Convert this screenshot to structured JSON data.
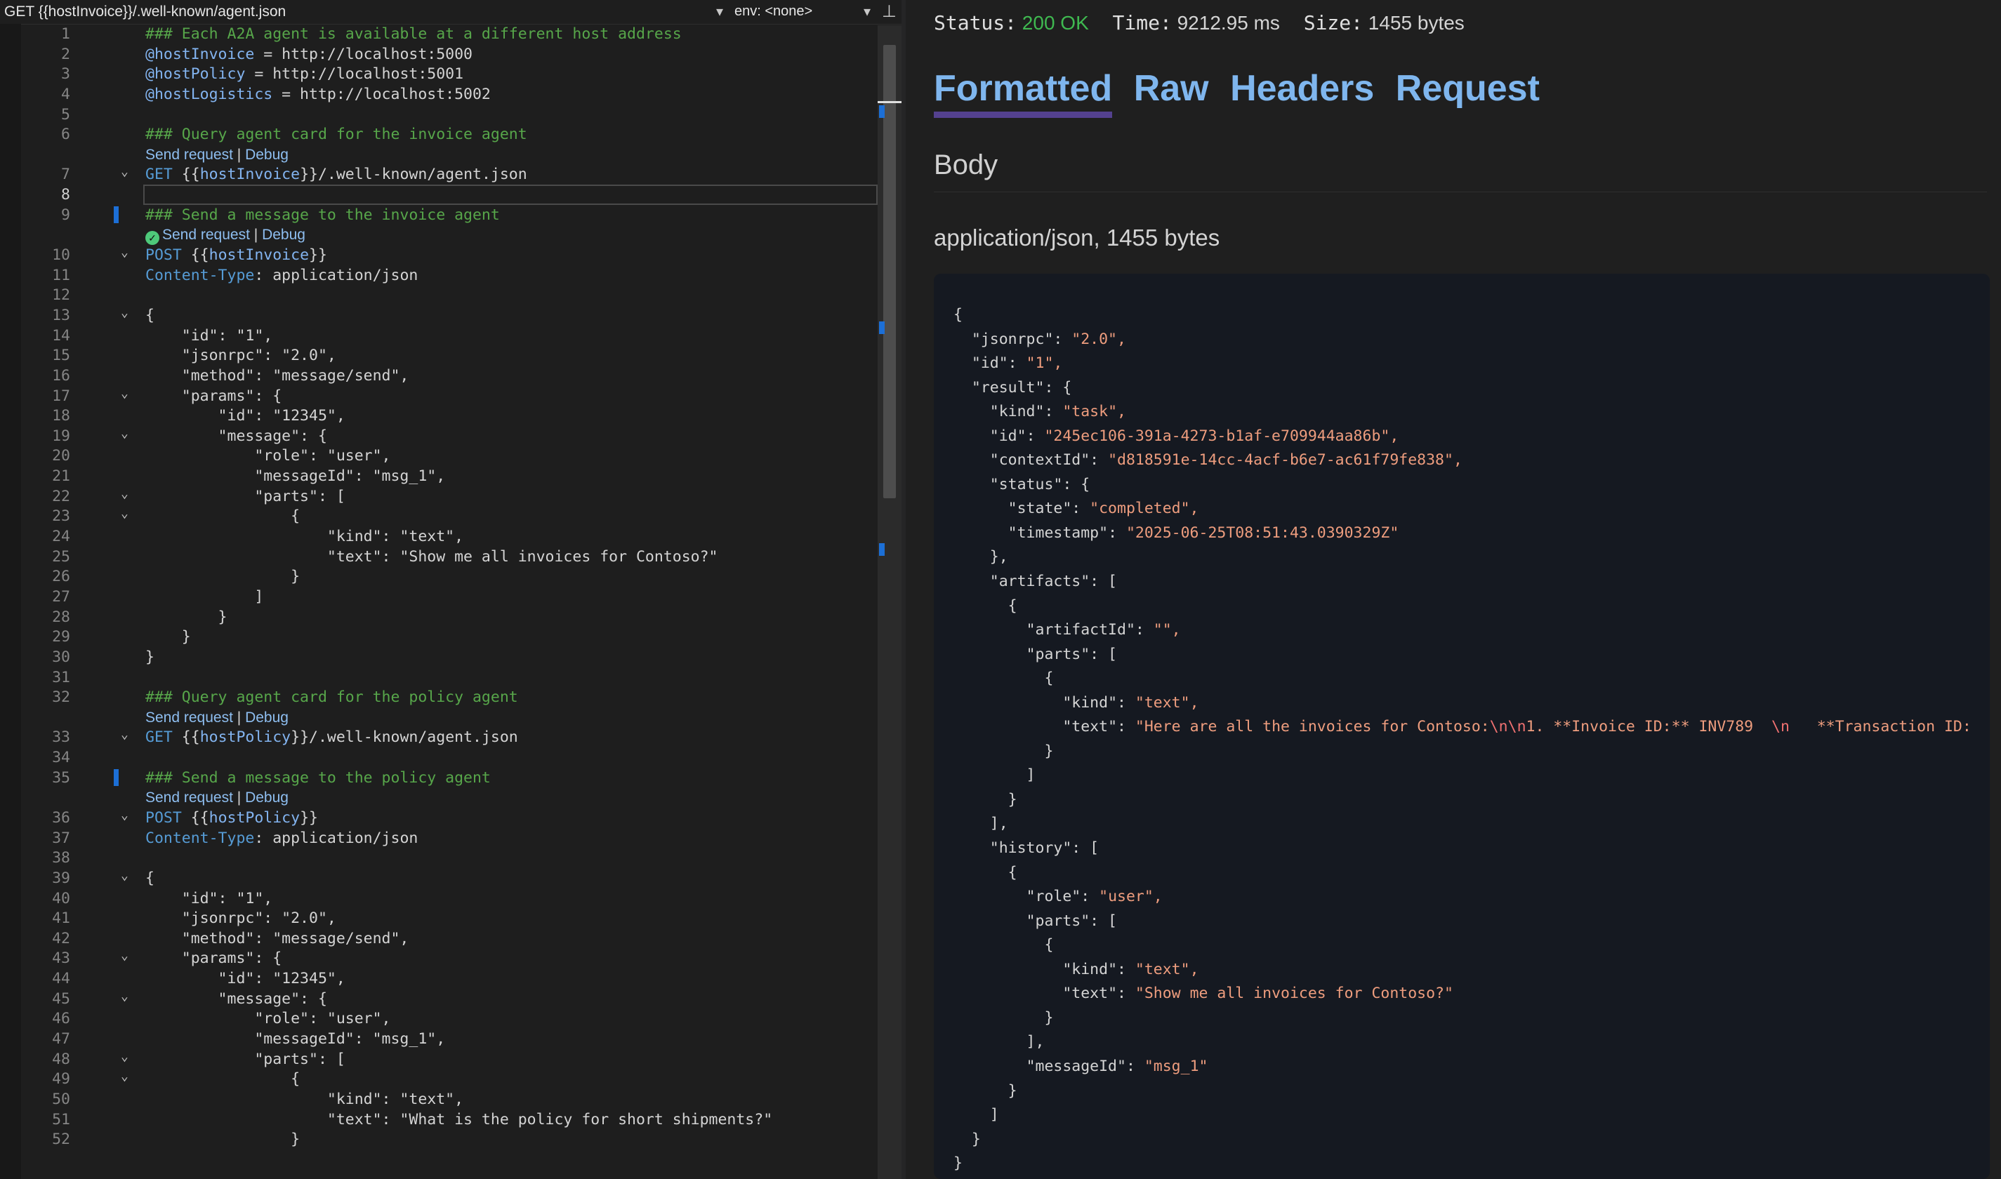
{
  "editor": {
    "nav_title": "GET {{hostInvoice}}/.well-known/agent.json",
    "env_select": "env: <none>",
    "code_lens": {
      "send": "Send request",
      "sep": "|",
      "debug": "Debug"
    },
    "lines": [
      {
        "n": "1",
        "t": "### Each A2A agent is available at a different host address"
      },
      {
        "n": "2",
        "t": "@hostInvoice = http://localhost:5000"
      },
      {
        "n": "3",
        "t": "@hostPolicy = http://localhost:5001"
      },
      {
        "n": "4",
        "t": "@hostLogistics = http://localhost:5002"
      },
      {
        "n": "5",
        "t": ""
      },
      {
        "n": "6",
        "t": "### Query agent card for the invoice agent"
      },
      {
        "n": "",
        "t": "LENS"
      },
      {
        "n": "7",
        "t": "GET {{hostInvoice}}/.well-known/agent.json"
      },
      {
        "n": "8",
        "t": ""
      },
      {
        "n": "9",
        "t": "### Send a message to the invoice agent"
      },
      {
        "n": "",
        "t": "LENS_OK"
      },
      {
        "n": "10",
        "t": "POST {{hostInvoice}}"
      },
      {
        "n": "11",
        "t": "Content-Type: application/json"
      },
      {
        "n": "12",
        "t": ""
      },
      {
        "n": "13",
        "t": "{"
      },
      {
        "n": "14",
        "t": "    \"id\": \"1\","
      },
      {
        "n": "15",
        "t": "    \"jsonrpc\": \"2.0\","
      },
      {
        "n": "16",
        "t": "    \"method\": \"message/send\","
      },
      {
        "n": "17",
        "t": "    \"params\": {"
      },
      {
        "n": "18",
        "t": "        \"id\": \"12345\","
      },
      {
        "n": "19",
        "t": "        \"message\": {"
      },
      {
        "n": "20",
        "t": "            \"role\": \"user\","
      },
      {
        "n": "21",
        "t": "            \"messageId\": \"msg_1\","
      },
      {
        "n": "22",
        "t": "            \"parts\": ["
      },
      {
        "n": "23",
        "t": "                {"
      },
      {
        "n": "24",
        "t": "                    \"kind\": \"text\","
      },
      {
        "n": "25",
        "t": "                    \"text\": \"Show me all invoices for Contoso?\""
      },
      {
        "n": "26",
        "t": "                }"
      },
      {
        "n": "27",
        "t": "            ]"
      },
      {
        "n": "28",
        "t": "        }"
      },
      {
        "n": "29",
        "t": "    }"
      },
      {
        "n": "30",
        "t": "}"
      },
      {
        "n": "31",
        "t": ""
      },
      {
        "n": "32",
        "t": "### Query agent card for the policy agent"
      },
      {
        "n": "",
        "t": "LENS"
      },
      {
        "n": "33",
        "t": "GET {{hostPolicy}}/.well-known/agent.json"
      },
      {
        "n": "34",
        "t": ""
      },
      {
        "n": "35",
        "t": "### Send a message to the policy agent"
      },
      {
        "n": "",
        "t": "LENS"
      },
      {
        "n": "36",
        "t": "POST {{hostPolicy}}"
      },
      {
        "n": "37",
        "t": "Content-Type: application/json"
      },
      {
        "n": "38",
        "t": ""
      },
      {
        "n": "39",
        "t": "{"
      },
      {
        "n": "40",
        "t": "    \"id\": \"1\","
      },
      {
        "n": "41",
        "t": "    \"jsonrpc\": \"2.0\","
      },
      {
        "n": "42",
        "t": "    \"method\": \"message/send\","
      },
      {
        "n": "43",
        "t": "    \"params\": {"
      },
      {
        "n": "44",
        "t": "        \"id\": \"12345\","
      },
      {
        "n": "45",
        "t": "        \"message\": {"
      },
      {
        "n": "46",
        "t": "            \"role\": \"user\","
      },
      {
        "n": "47",
        "t": "            \"messageId\": \"msg_1\","
      },
      {
        "n": "48",
        "t": "            \"parts\": ["
      },
      {
        "n": "49",
        "t": "                {"
      },
      {
        "n": "50",
        "t": "                    \"kind\": \"text\","
      },
      {
        "n": "51",
        "t": "                    \"text\": \"What is the policy for short shipments?\""
      },
      {
        "n": "52",
        "t": "                }"
      }
    ]
  },
  "response": {
    "status_label": "Status:",
    "status_value": "200 OK",
    "time_label": "Time:",
    "time_value": "9212.95 ms",
    "size_label": "Size:",
    "size_value": "1455 bytes",
    "tabs": [
      "Formatted",
      "Raw",
      "Headers",
      "Request"
    ],
    "body_heading": "Body",
    "content_type": "application/json, 1455 bytes",
    "json_lines": [
      "{",
      "  \"jsonrpc\": \"2.0\",",
      "  \"id\": \"1\",",
      "  \"result\": {",
      "    \"kind\": \"task\",",
      "    \"id\": \"245ec106-391a-4273-b1af-e709944aa86b\",",
      "    \"contextId\": \"d818591e-14cc-4acf-b6e7-ac61f79fe838\",",
      "    \"status\": {",
      "      \"state\": \"completed\",",
      "      \"timestamp\": \"2025-06-25T08:51:43.0390329Z\"",
      "    },",
      "    \"artifacts\": [",
      "      {",
      "        \"artifactId\": \"\",",
      "        \"parts\": [",
      "          {",
      "            \"kind\": \"text\",",
      "            \"text\": \"Here are all the invoices for Contoso:\\n\\n1. **Invoice ID:** INV789  \\n   **Transaction ID:",
      "          }",
      "        ]",
      "      }",
      "    ],",
      "    \"history\": [",
      "      {",
      "        \"role\": \"user\",",
      "        \"parts\": [",
      "          {",
      "            \"kind\": \"text\",",
      "            \"text\": \"Show me all invoices for Contoso?\"",
      "          }",
      "        ],",
      "        \"messageId\": \"msg_1\"",
      "      }",
      "    ]",
      "  }",
      "}"
    ]
  },
  "colors": {
    "comment": "#57a64a",
    "variable": "#83b4f0",
    "keyword": "#569cd6",
    "json_string": "#ee9d7e",
    "status_ok": "#3fb950",
    "tab_link": "#7fb6ee",
    "tab_underline": "#54418f"
  }
}
